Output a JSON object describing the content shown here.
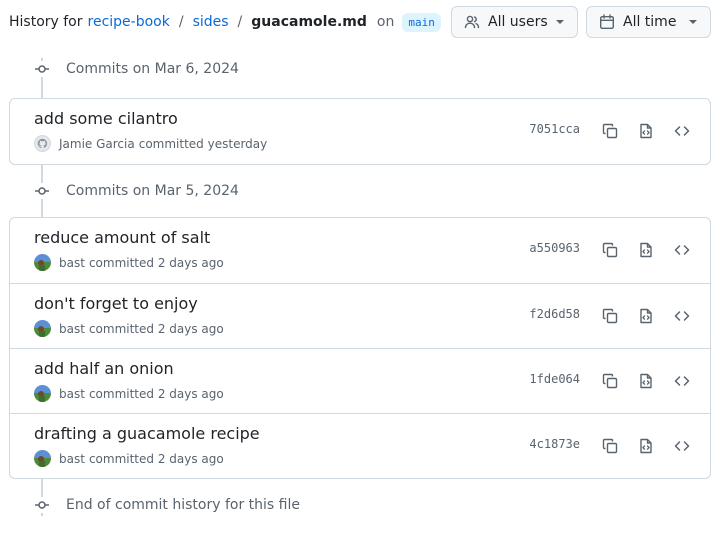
{
  "header": {
    "history_for": "History for",
    "repo": "recipe-book",
    "sep1": "/",
    "folder": "sides",
    "sep2": "/",
    "file": "guacamole.md",
    "on": "on",
    "branch": "main"
  },
  "filters": {
    "users_label": "All users",
    "time_label": "All time"
  },
  "groups": [
    {
      "heading": "Commits on Mar 6, 2024",
      "commits": [
        {
          "message": "add some cilantro",
          "author": "Jamie Garcia",
          "verb": "committed",
          "when": "yesterday",
          "sha": "7051cca",
          "avatar": "github-default-avatar"
        }
      ]
    },
    {
      "heading": "Commits on Mar 5, 2024",
      "commits": [
        {
          "message": "reduce amount of salt",
          "author": "bast",
          "verb": "committed",
          "when": "2 days ago",
          "sha": "a550963",
          "avatar": "photo-avatar"
        },
        {
          "message": "don't forget to enjoy",
          "author": "bast",
          "verb": "committed",
          "when": "2 days ago",
          "sha": "f2d6d58",
          "avatar": "photo-avatar"
        },
        {
          "message": "add half an onion",
          "author": "bast",
          "verb": "committed",
          "when": "2 days ago",
          "sha": "1fde064",
          "avatar": "photo-avatar"
        },
        {
          "message": "drafting a guacamole recipe",
          "author": "bast",
          "verb": "committed",
          "when": "2 days ago",
          "sha": "4c1873e",
          "avatar": "photo-avatar"
        }
      ]
    }
  ],
  "footer": {
    "end_text": "End of commit history for this file"
  },
  "colors": {
    "link": "#0969da",
    "muted": "#59636e",
    "border": "#d1d9e0",
    "branch_bg": "#ddf4ff"
  }
}
